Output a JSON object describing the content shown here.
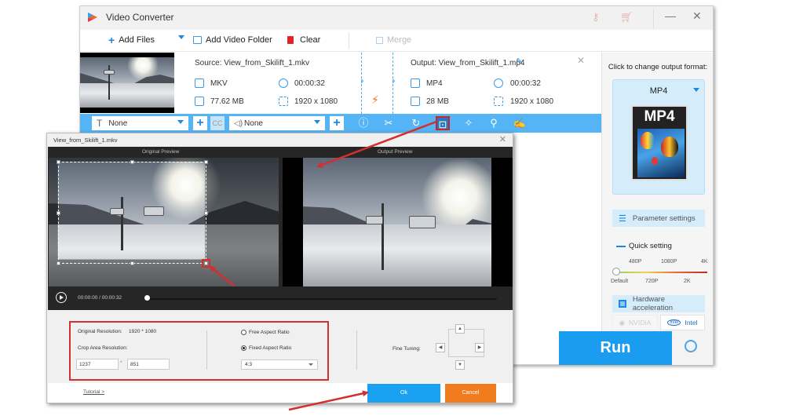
{
  "window": {
    "title": "Video Converter",
    "controls": {
      "minimize": "—",
      "close": "✕"
    }
  },
  "toolbar": {
    "add_files": "Add Files",
    "add_video_folder": "Add Video Folder",
    "clear": "Clear",
    "merge": "Merge"
  },
  "file": {
    "source_label": "Source: View_from_Skilift_1.mkv",
    "output_label": "Output: View_from_Skilift_1.mp4",
    "source": {
      "format": "MKV",
      "duration": "00:00:32",
      "size": "77.62 MB",
      "resolution": "1920 x 1080"
    },
    "output": {
      "format": "MP4",
      "duration": "00:00:32",
      "size": "28 MB",
      "resolution": "1920 x 1080"
    }
  },
  "edit_bar": {
    "subtitle_value": "None",
    "audio_value": "None",
    "cc_label": "CC",
    "tools": [
      "info",
      "cut",
      "rotate",
      "crop",
      "effects",
      "watermark",
      "subtitle-edit"
    ],
    "active_tool": "crop"
  },
  "right_panel": {
    "format_hint": "Click to change output format:",
    "format": "MP4",
    "format_icon_label": "MP4",
    "parameter_settings": "Parameter settings",
    "quick_setting": "Quick setting",
    "quality_top": [
      "480P",
      "1080P",
      "4K"
    ],
    "quality_bottom": [
      "Default",
      "720P",
      "2K"
    ],
    "quality_selected": "Default",
    "hardware_acceleration": "Hardware acceleration",
    "gpu_nvidia": "NVIDIA",
    "gpu_intel": "Intel",
    "gpu_intel_logo": "intel"
  },
  "run": {
    "label": "Run"
  },
  "crop_dialog": {
    "title": "View_from_Skilift_1.mkv",
    "original_preview": "Original Preview",
    "output_preview": "Output Preview",
    "time_current": "00:00:00",
    "time_separator": "/",
    "time_total": "00:00:32",
    "playback_progress": 0,
    "original_resolution_label": "Original Resolution:",
    "original_resolution_value": "1920 * 1080",
    "crop_area_label": "Crop Area Resolution:",
    "crop_width": "1237",
    "crop_times": "*",
    "crop_height": "851",
    "free_aspect": "Free Aspect Ratio",
    "fixed_aspect": "Fixed Aspect Ratio",
    "aspect_mode": "fixed",
    "ratio_value": "4:3",
    "fine_tuning_label": "Fine Tuning:",
    "tutorial": "Tutorial >",
    "ok": "Ok",
    "cancel": "Cancel"
  },
  "colors": {
    "accent_blue": "#1a9cf0",
    "edit_bar": "#55b4f5",
    "cancel_orange": "#f07c1e",
    "annotation_red": "#d32f2f"
  }
}
